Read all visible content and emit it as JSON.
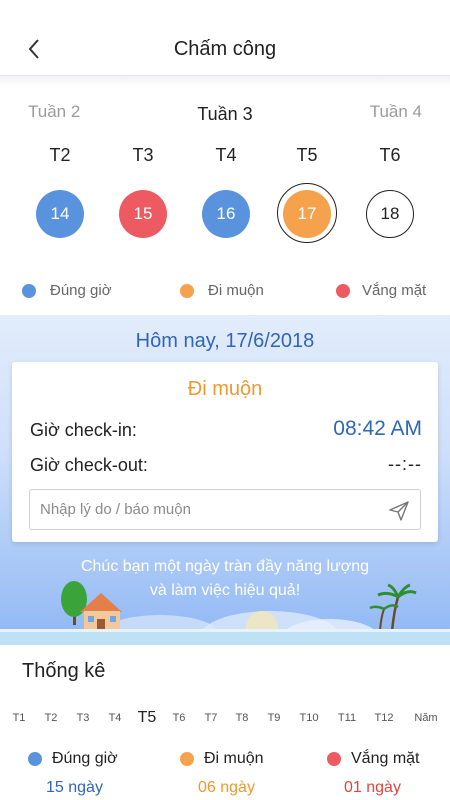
{
  "header": {
    "title": "Chấm công",
    "back_icon": "chevron-left-icon"
  },
  "weeks": {
    "prev": "Tuần 2",
    "current": "Tuần 3",
    "next": "Tuần 4"
  },
  "days": [
    {
      "label": "T2",
      "date": "14",
      "status": "on_time"
    },
    {
      "label": "T3",
      "date": "15",
      "status": "absent"
    },
    {
      "label": "T4",
      "date": "16",
      "status": "on_time"
    },
    {
      "label": "T5",
      "date": "17",
      "status": "late",
      "selected": true
    },
    {
      "label": "T6",
      "date": "18",
      "status": "none"
    }
  ],
  "legend": [
    {
      "label": "Đúng giờ",
      "color": "#5a93dd"
    },
    {
      "label": "Đi muộn",
      "color": "#f6a14c"
    },
    {
      "label": "Vắng mặt",
      "color": "#ee5a62"
    }
  ],
  "today": {
    "title": "Hôm nay, 17/6/2018",
    "status": "Đi muộn",
    "checkin_label": "Giờ check-in:",
    "checkin_time": "08:42 AM",
    "checkout_label": "Giờ check-out:",
    "checkout_time": "--:--",
    "reason_placeholder": "Nhập lý do / báo muộn",
    "message_line1": "Chúc bạn một ngày tràn đầy năng lượng",
    "message_line2": "và làm việc hiệu quả!"
  },
  "stats": {
    "title": "Thống kê",
    "months": [
      "T1",
      "T2",
      "T3",
      "T4",
      "T5",
      "T6",
      "T7",
      "T8",
      "T9",
      "T10",
      "T11",
      "T12",
      "Năm"
    ],
    "active_month": "T5",
    "items": [
      {
        "label": "Đúng giờ",
        "value": "15 ngày",
        "color": "#5a93dd",
        "value_color": "#2f66b7"
      },
      {
        "label": "Đi muộn",
        "value": "06 ngày",
        "color": "#f6a14c",
        "value_color": "#f0982f"
      },
      {
        "label": "Vắng mặt",
        "value": "01 ngày",
        "color": "#ee5a62",
        "value_color": "#e0453c"
      }
    ]
  },
  "colors": {
    "accent": "#2f66b7",
    "late": "#f0982f"
  }
}
